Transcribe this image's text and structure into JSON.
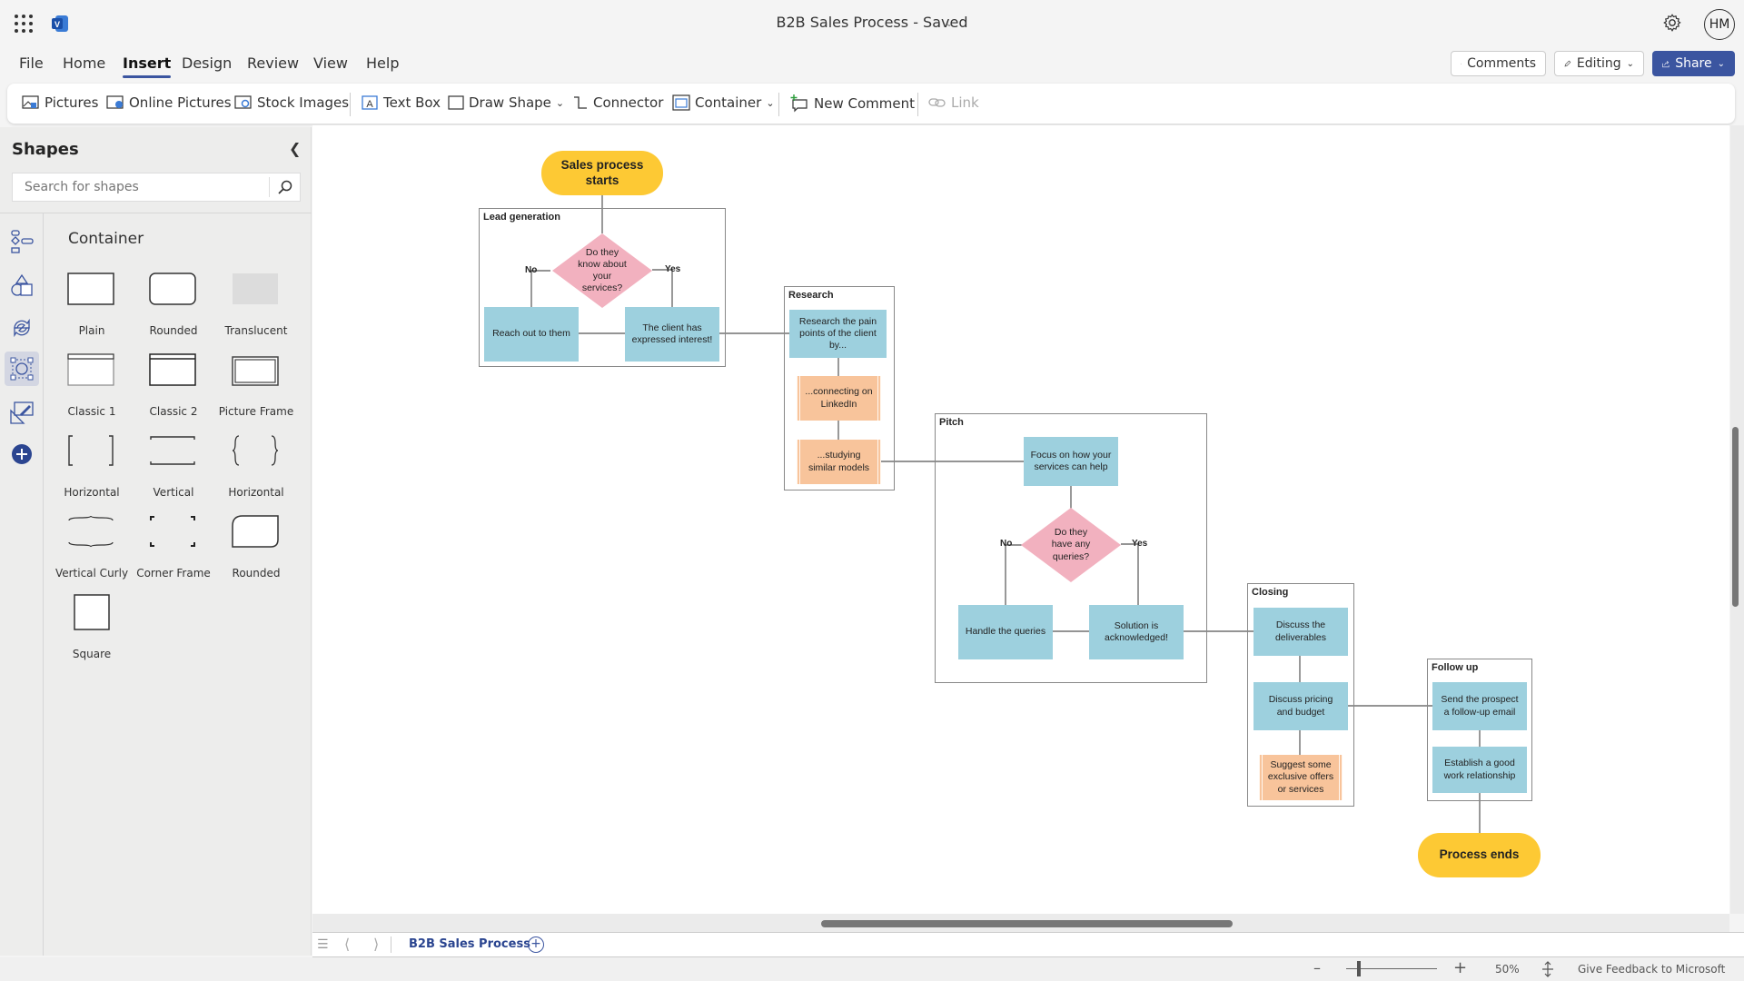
{
  "titlebar": {
    "title": "B2B Sales Process  -  Saved",
    "avatar_initials": "HM"
  },
  "menu": [
    "File",
    "Home",
    "Insert",
    "Design",
    "Review",
    "View",
    "Help"
  ],
  "active_menu": "Insert",
  "header_buttons": {
    "comments": "Comments",
    "editing": "Editing",
    "share": "Share"
  },
  "ribbon": {
    "pictures": "Pictures",
    "online_pictures": "Online Pictures",
    "stock_images": "Stock Images",
    "text_box": "Text Box",
    "draw_shape": "Draw Shape",
    "connector": "Connector",
    "container": "Container",
    "new_comment": "New Comment",
    "link": "Link"
  },
  "sidebar": {
    "title": "Shapes",
    "search_placeholder": "Search for shapes",
    "stencil_title": "Container",
    "shapes": [
      "Plain",
      "Rounded",
      "Translucent",
      "Classic 1",
      "Classic 2",
      "Picture Frame",
      "Horizontal",
      "Vertical",
      "Horizontal",
      "Vertical Curly",
      "Corner Frame",
      "Rounded",
      "Square"
    ]
  },
  "diagram": {
    "start": "Sales process starts",
    "end": "Process ends",
    "containers": {
      "lead": "Lead generation",
      "research": "Research",
      "pitch": "Pitch",
      "closing": "Closing",
      "followup": "Follow up"
    },
    "lead": {
      "decision": "Do they know about your services?",
      "no": "No",
      "yes": "Yes",
      "reach": "Reach out to them",
      "interest": "The client has expressed interest!"
    },
    "research": {
      "pain": "Research the pain points of the client by...",
      "linkedin": "...connecting on LinkedIn",
      "models": "...studying similar models"
    },
    "pitch": {
      "focus": "Focus on how your services can help",
      "decision": "Do they have any queries?",
      "no": "No",
      "yes": "Yes",
      "handle": "Handle the queries",
      "solution": "Solution is acknowledged!"
    },
    "closing": {
      "deliverables": "Discuss the deliverables",
      "pricing": "Discuss pricing and budget",
      "offers": "Suggest some exclusive offers or services"
    },
    "followup": {
      "email": "Send the prospect a follow-up email",
      "relationship": "Establish a good work relationship"
    }
  },
  "tabs": {
    "page": "B2B Sales Process"
  },
  "status": {
    "zoom": "50%",
    "feedback": "Give Feedback to Microsoft",
    "zoom_level": 0.5
  },
  "colors": {
    "accent": "#3b55a0",
    "process": "#9dd0de",
    "subprocess": "#f8c49b",
    "decision": "#f2b1bf",
    "terminator": "#fdc934"
  }
}
